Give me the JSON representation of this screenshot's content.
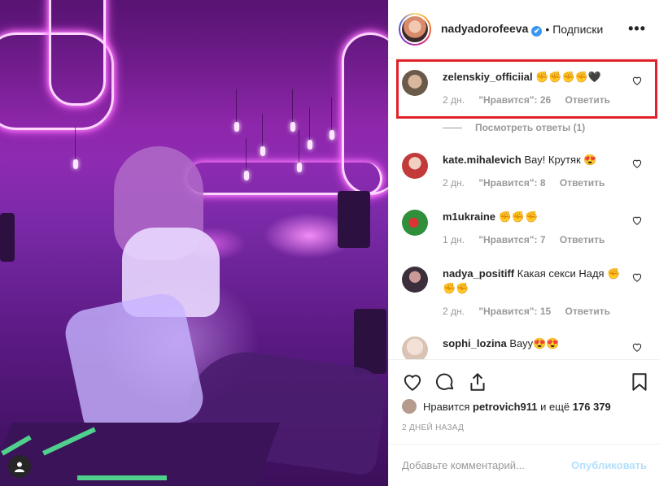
{
  "post": {
    "username": "nadyadorofeeva",
    "verified_mark": "✔",
    "separator": "•",
    "follow_status": "Подписки",
    "more": "•••"
  },
  "comments": [
    {
      "user": "zelenskiy_officiial",
      "text": "✊✊✊✊🖤",
      "time": "2 дн.",
      "likes": "\"Нравится\": 26",
      "reply": "Ответить",
      "avatar_color": "#6b5a4a"
    },
    {
      "user": "kate.mihalevich",
      "text": "Вау! Крутяк 😍",
      "time": "2 дн.",
      "likes": "\"Нравится\": 8",
      "reply": "Ответить",
      "avatar_color": "#c23a3a"
    },
    {
      "user": "m1ukraine",
      "text": "✊✊✊",
      "time": "1 дн.",
      "likes": "\"Нравится\": 7",
      "reply": "Ответить",
      "avatar_color": "#2f8f3a"
    },
    {
      "user": "nadya_positiff",
      "text": "Какая секси Надя ✊✊✊",
      "time": "2 дн.",
      "likes": "\"Нравится\": 15",
      "reply": "Ответить",
      "avatar_color": "#3a2f3a"
    },
    {
      "user": "sophi_lozina",
      "text": "Вауу😍😍",
      "time": "",
      "likes": "",
      "reply": "",
      "avatar_color": "#d9c3b5"
    }
  ],
  "view_replies": "Посмотреть ответы (1)",
  "likes_line": {
    "prefix": "Нравится",
    "user": "petrovich911",
    "middle": "и ещё",
    "count": "176 379"
  },
  "date": "2 ДНЕЙ НАЗАД",
  "add_comment": {
    "placeholder": "Добавьте комментарий...",
    "publish": "Опубликовать"
  },
  "colors": {
    "highlight_box": "#e0202a",
    "verified": "#3897f0",
    "publish_disabled": "#b2dffc",
    "meta_text": "#999999"
  },
  "icons": [
    "like-icon",
    "comment-icon",
    "share-icon",
    "save-icon",
    "heart-icon",
    "user-tag-icon",
    "more-icon"
  ]
}
